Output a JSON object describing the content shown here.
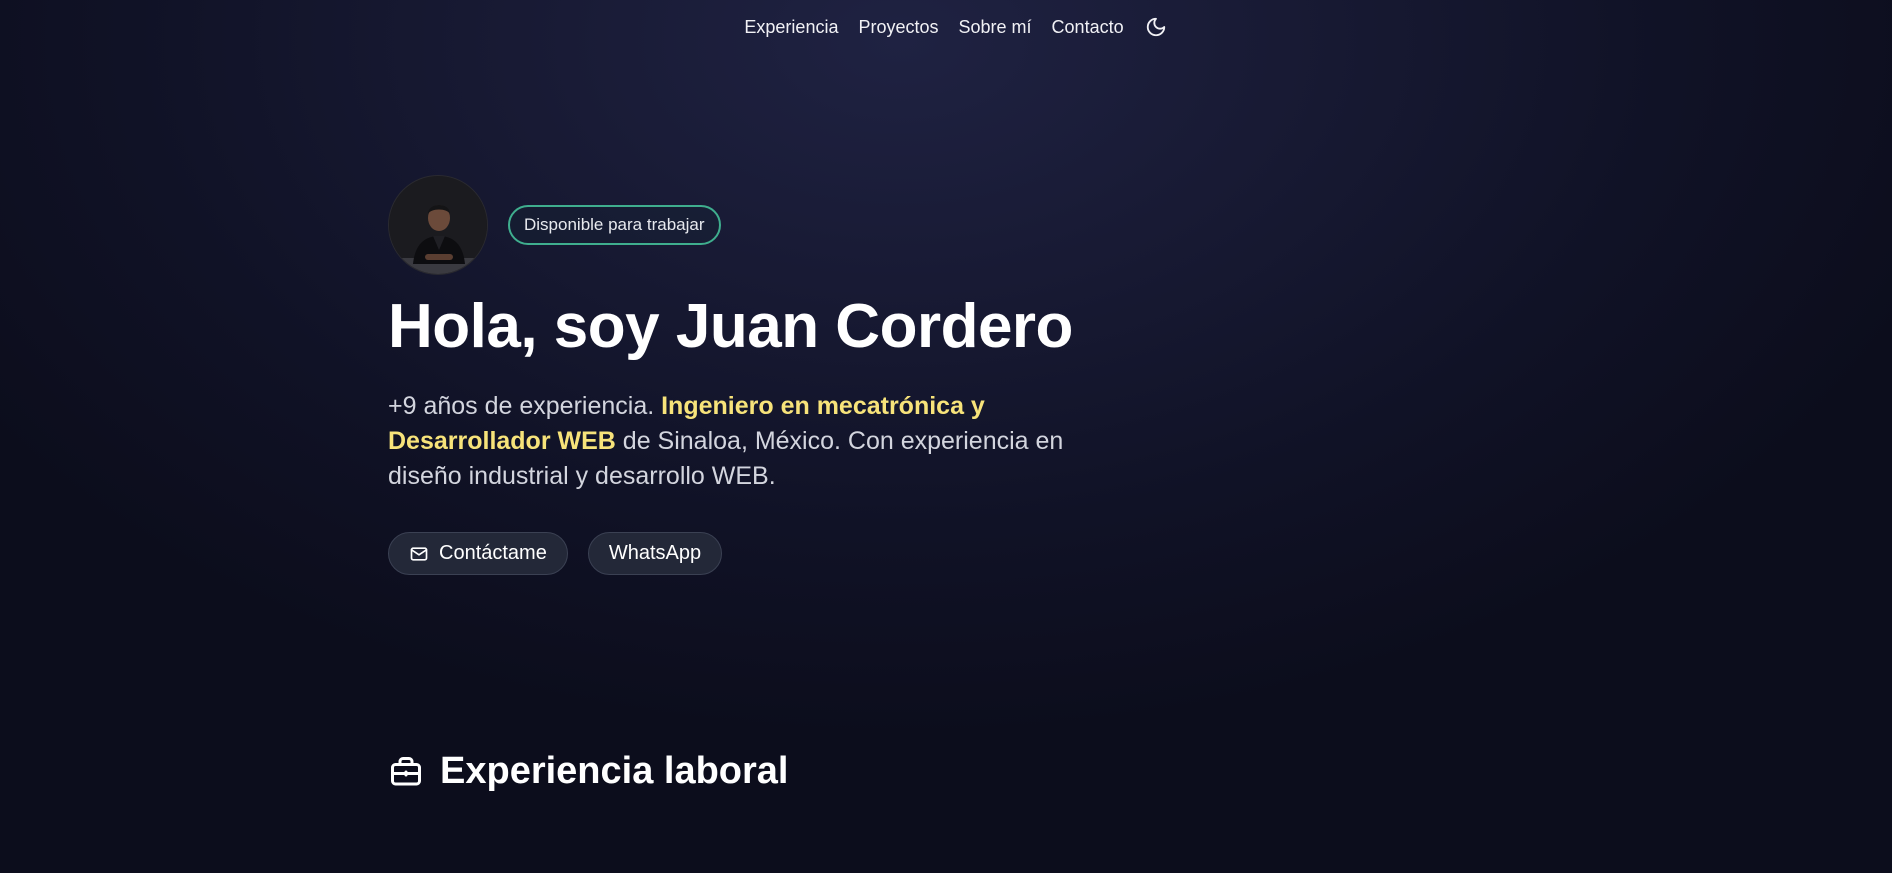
{
  "nav": {
    "items": [
      {
        "label": "Experiencia"
      },
      {
        "label": "Proyectos"
      },
      {
        "label": "Sobre mí"
      },
      {
        "label": "Contacto"
      }
    ],
    "theme_icon": "moon-icon"
  },
  "hero": {
    "avatar_icon": "profile-photo",
    "badge": "Disponible para trabajar",
    "title": "Hola, soy Juan Cordero",
    "desc_prefix": "+9 años de experiencia. ",
    "desc_highlight": "Ingeniero en mecatrónica y Desarrollador WEB",
    "desc_suffix": " de Sinaloa, México. Con experiencia en diseño industrial y desarrollo WEB.",
    "contact_button": "Contáctame",
    "contact_icon": "mail-icon",
    "whatsapp_button": "WhatsApp"
  },
  "experience": {
    "title": "Experiencia laboral",
    "icon": "briefcase-icon"
  },
  "colors": {
    "accent_highlight": "#f7e37a",
    "badge_border": "#3fae8e",
    "background": "#141630"
  }
}
